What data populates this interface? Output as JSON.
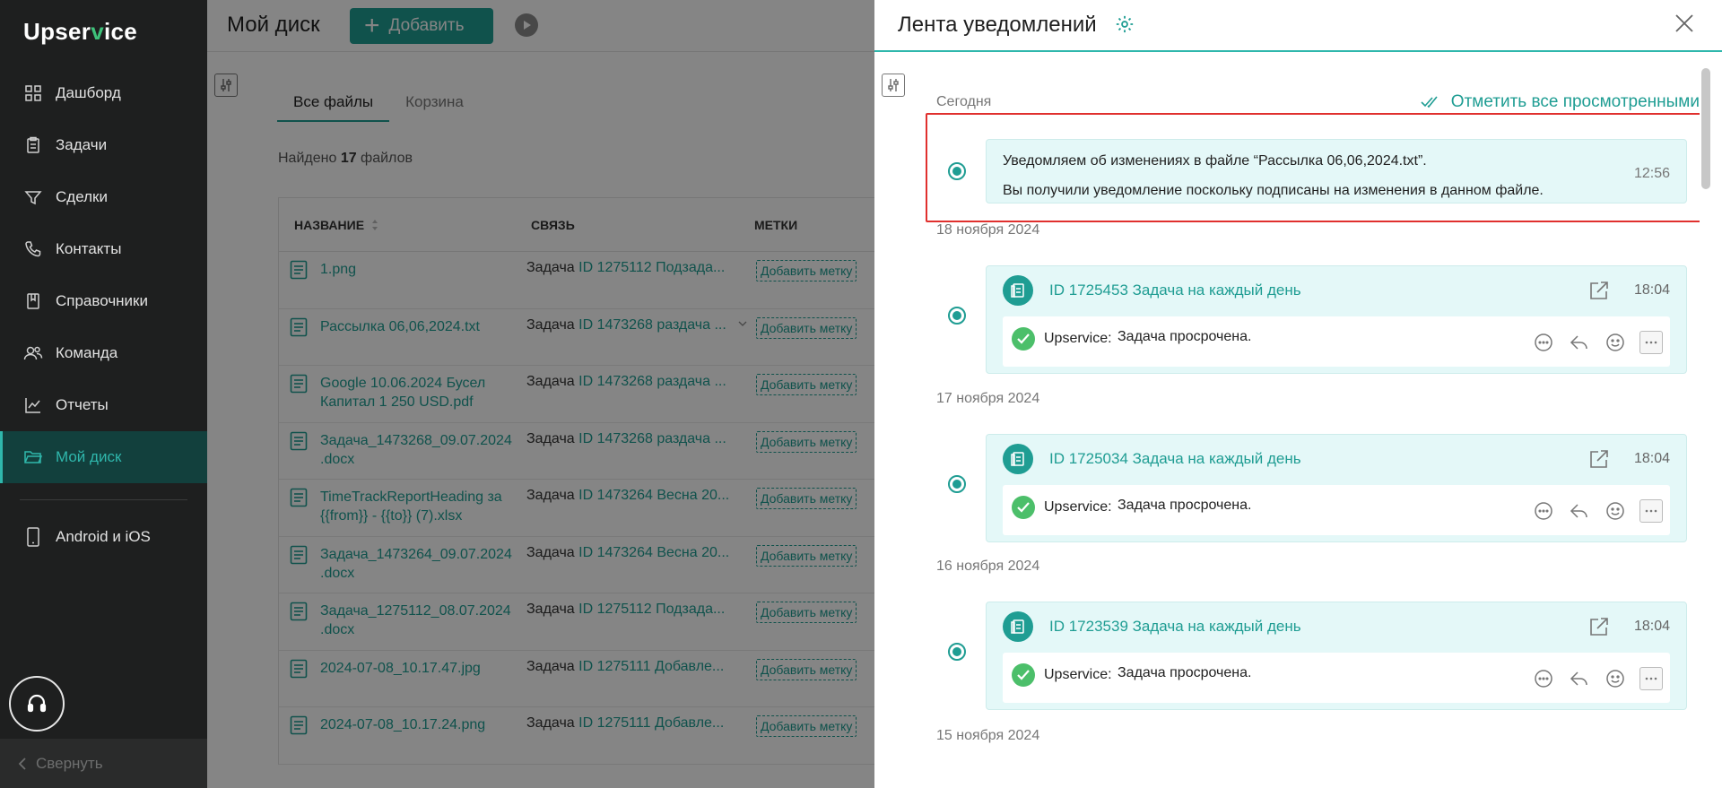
{
  "sidebar": {
    "logo_a": "Upser",
    "logo_v": "v",
    "logo_b": "ice",
    "items": [
      {
        "label": "Дашборд",
        "icon": "dashboard-icon"
      },
      {
        "label": "Задачи",
        "icon": "tasks-icon"
      },
      {
        "label": "Сделки",
        "icon": "deals-icon"
      },
      {
        "label": "Контакты",
        "icon": "contacts-icon"
      },
      {
        "label": "Справочники",
        "icon": "directory-icon"
      },
      {
        "label": "Команда",
        "icon": "team-icon"
      },
      {
        "label": "Отчеты",
        "icon": "reports-icon"
      },
      {
        "label": "Мой диск",
        "icon": "folder-icon"
      }
    ],
    "mobile": "Android и iOS",
    "collapse": "Свернуть"
  },
  "main": {
    "title": "Мой диск",
    "add_label": "Добавить",
    "tabs": [
      "Все файлы",
      "Корзина"
    ],
    "found_prefix": "Найдено ",
    "found_count": "17",
    "found_suffix": " файлов",
    "columns": [
      "НАЗВАНИЕ",
      "СВЯЗЬ",
      "МЕТКИ"
    ],
    "tag_label": "Добавить метку",
    "rows": [
      {
        "name": "1.png",
        "type": "Задача",
        "id": "ID 1275112 Подзада..."
      },
      {
        "name": "Рассылка 06,06,2024.txt",
        "type": "Задача",
        "id": "ID 1473268 раздача ..."
      },
      {
        "name": "Google 10.06.2024 Бусел Капитал 1 250 USD.pdf",
        "type": "Задача",
        "id": "ID 1473268 раздача ..."
      },
      {
        "name": "Задача_1473268_09.07.2024 .docx",
        "type": "Задача",
        "id": "ID 1473268 раздача ..."
      },
      {
        "name": "TimeTrackReportHeading за {{from}} - {{to}} (7).xlsx",
        "type": "Задача",
        "id": "ID 1473264 Весна 20..."
      },
      {
        "name": "Задача_1473264_09.07.2024 .docx",
        "type": "Задача",
        "id": "ID 1473264 Весна 20..."
      },
      {
        "name": "Задача_1275112_08.07.2024 .docx",
        "type": "Задача",
        "id": "ID 1275112 Подзада..."
      },
      {
        "name": "2024-07-08_10.17.47.jpg",
        "type": "Задача",
        "id": "ID 1275111 Добавле..."
      },
      {
        "name": "2024-07-08_10.17.24.png",
        "type": "Задача",
        "id": "ID 1275111 Добавле..."
      }
    ]
  },
  "panel": {
    "title": "Лента уведомлений",
    "mark_all": "Отметить все просмотренными",
    "today": "Сегодня",
    "first": {
      "line1": "Уведомляем об изменениях в файле “Рассылка 06,06,2024.txt”.",
      "line2": "Вы получили уведомление поскольку подписаны на изменения в данном файле.",
      "time": "12:56"
    },
    "groups": [
      {
        "date": "18 ноября 2024",
        "title": "ID 1725453 Задача на каждый день",
        "time": "18:04",
        "author": "Upservice:",
        "message": "Задача просрочена."
      },
      {
        "date": "17 ноября 2024",
        "title": "ID 1725034 Задача на каждый день",
        "time": "18:04",
        "author": "Upservice:",
        "message": "Задача просрочена."
      },
      {
        "date": "16 ноября 2024",
        "title": "ID 1723539 Задача на каждый день",
        "time": "18:04",
        "author": "Upservice:",
        "message": "Задача просрочена."
      }
    ],
    "last_date": "15 ноября 2024"
  },
  "colors": {
    "accent": "#1f9d93",
    "sidebar": "#1e1f1f",
    "highlight": "#e0302e"
  }
}
